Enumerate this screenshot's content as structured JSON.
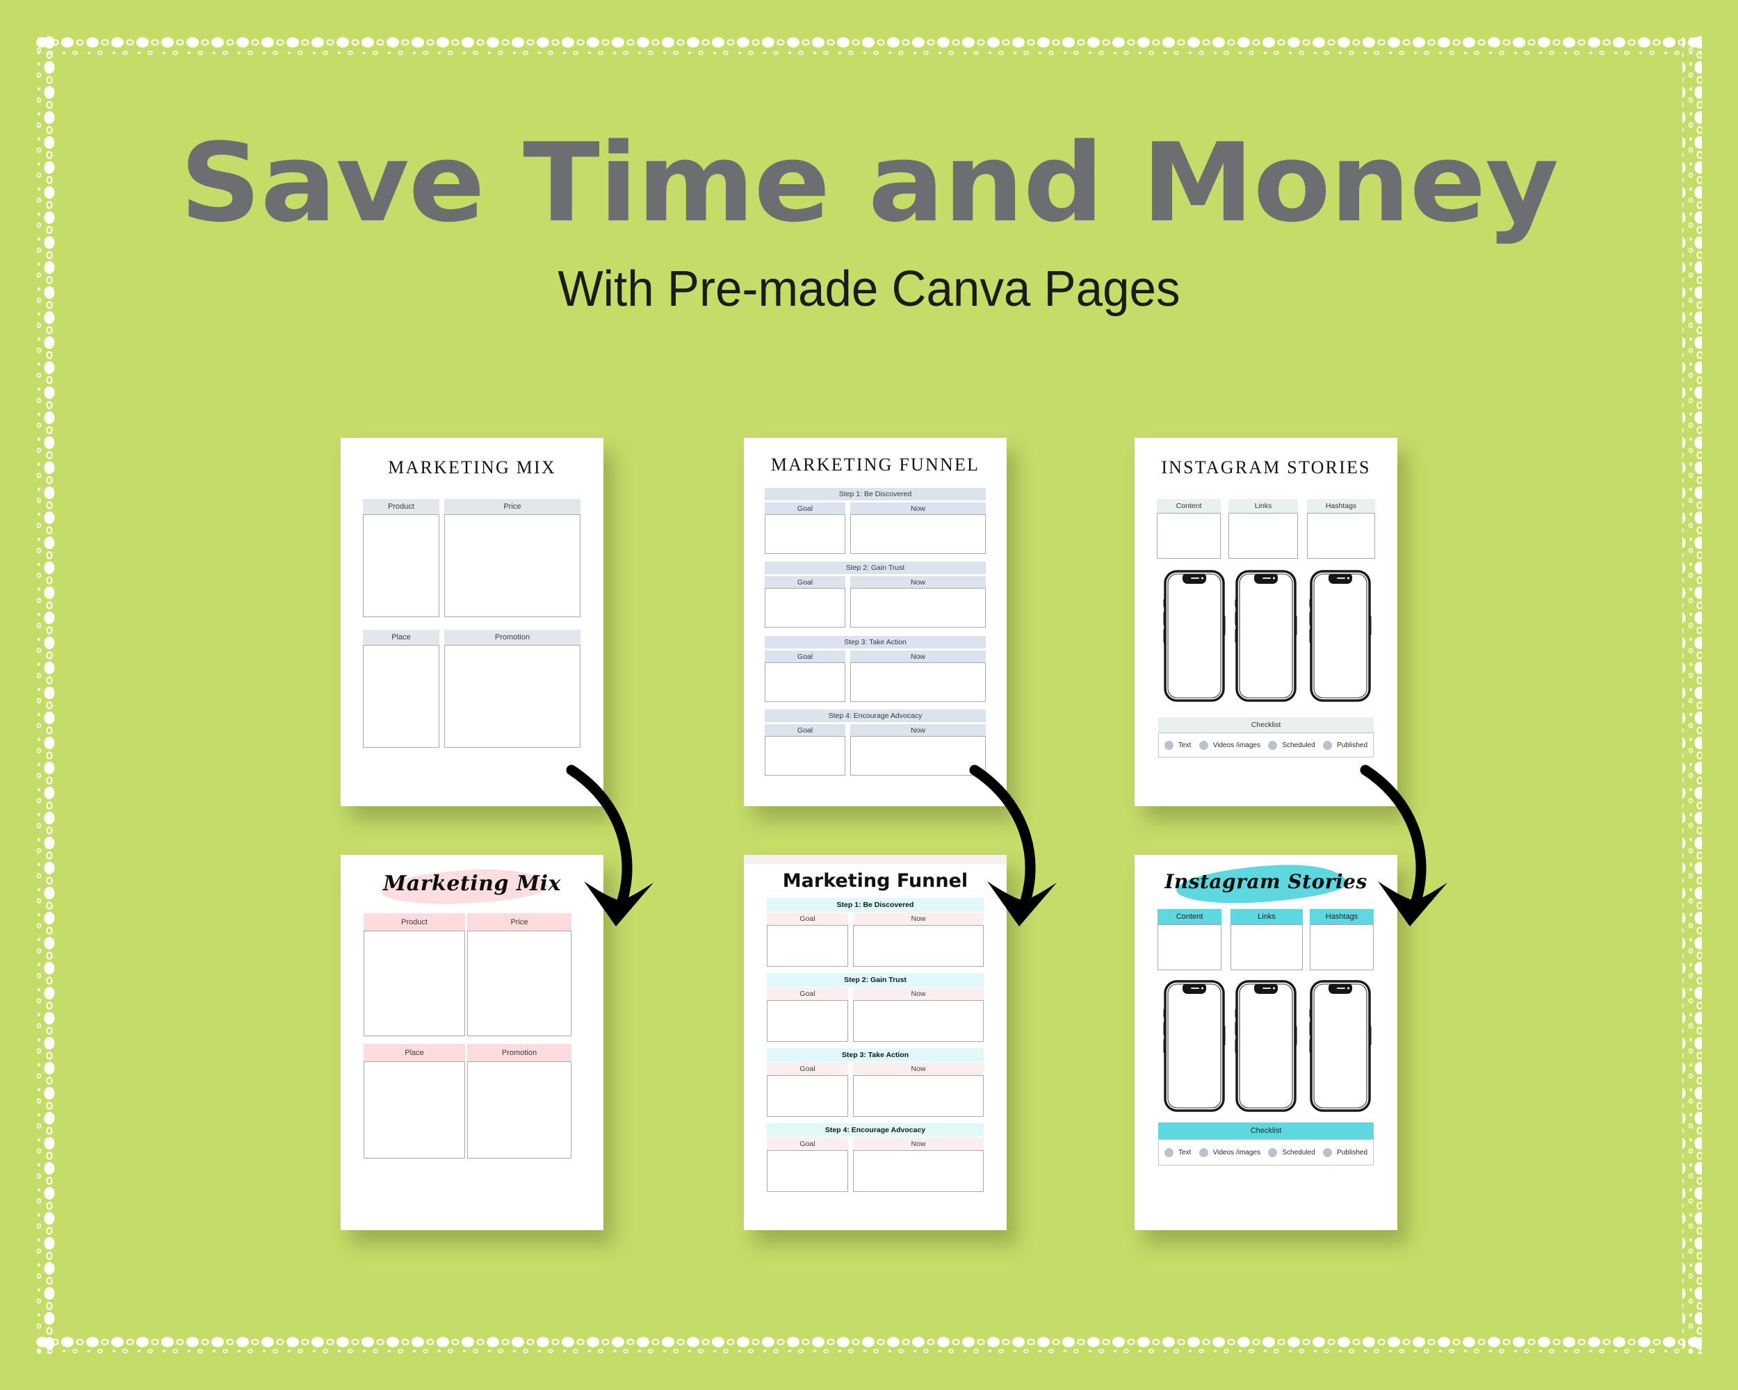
{
  "page": {
    "background_color": "#c6dc68",
    "headline": "Save Time and Money",
    "subheadline": "With Pre-made Canva Pages"
  },
  "colors": {
    "headline": "#6d6e71",
    "subheadline": "#1b1b1b",
    "plain_header_grey": "#e3e7ec",
    "plain_header_bluegrey": "#dbe3ec",
    "plain_header_mint": "#e8f1ee",
    "styled_pink": "#fbdbdc",
    "styled_cyan": "#5ed8e0",
    "styled_pale_cyan": "#e1f8fb",
    "styled_pale_pink": "#fbeeee",
    "checklist_dot": "#b9c3cf",
    "arrow": "#000000"
  },
  "templates": {
    "marketing_mix": {
      "plain_title": "MARKETING MIX",
      "styled_title": "Marketing Mix",
      "quadrants": [
        "Product",
        "Price",
        "Place",
        "Promotion"
      ]
    },
    "marketing_funnel": {
      "plain_title": "MARKETING FUNNEL",
      "styled_title": "Marketing Funnel",
      "steps": [
        {
          "label": "Step 1: Be Discovered",
          "columns": [
            "Goal",
            "Now"
          ]
        },
        {
          "label": "Step 2: Gain Trust",
          "columns": [
            "Goal",
            "Now"
          ]
        },
        {
          "label": "Step 3: Take Action",
          "columns": [
            "Goal",
            "Now"
          ]
        },
        {
          "label": "Step 4: Encourage Advocacy",
          "columns": [
            "Goal",
            "Now"
          ]
        }
      ]
    },
    "instagram_stories": {
      "plain_title": "INSTAGRAM STORIES",
      "styled_title": "Instagram Stories",
      "columns": [
        "Content",
        "Links",
        "Hashtags"
      ],
      "checklist_title": "Checklist",
      "checklist_items": [
        "Text",
        "Videos /images",
        "Scheduled",
        "Published"
      ],
      "phone_count": 3
    }
  },
  "arrows": {
    "count": 3,
    "direction": "curved-down-arrow",
    "labels": [
      "arrow-mix",
      "arrow-funnel",
      "arrow-instagram"
    ]
  }
}
